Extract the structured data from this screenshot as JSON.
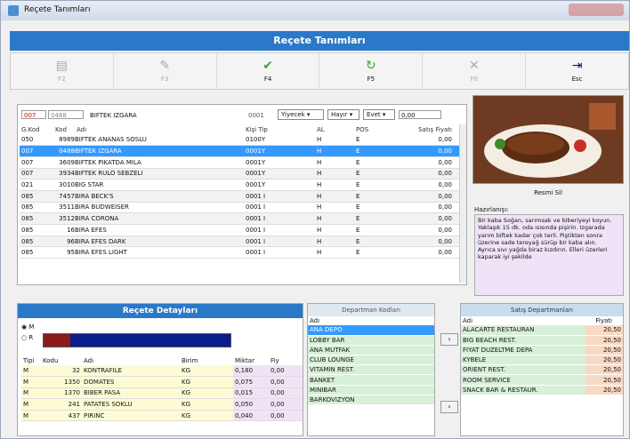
{
  "window": {
    "title": "Reçete Tanımları"
  },
  "header": {
    "title": "Reçete Tanımları"
  },
  "toolbar": [
    {
      "icon": "save-icon",
      "label": "F2",
      "enabled": false
    },
    {
      "icon": "edit-icon",
      "label": "F3",
      "enabled": false
    },
    {
      "icon": "check-icon",
      "label": "F4",
      "enabled": true
    },
    {
      "icon": "refresh-icon",
      "label": "F5",
      "enabled": true
    },
    {
      "icon": "close-icon",
      "label": "F6",
      "enabled": false
    },
    {
      "icon": "exit-icon",
      "label": "Esc",
      "enabled": true
    }
  ],
  "edit": {
    "code": "007",
    "code2": "0488",
    "name": "BIFTEK IZGARA",
    "type_code": "0001",
    "type": "Yiyecek",
    "al": "Hayır",
    "pos": "Evet",
    "price": "0,00"
  },
  "grid": {
    "columns": [
      "G.Kod",
      "Kod",
      "Adı",
      "Kişi Tip",
      "AL",
      "POS",
      "Satış Fiyatı"
    ],
    "rows": [
      {
        "g": "050",
        "kod": "8989",
        "ad": "BIFTEK ANANAS SOSLU",
        "tip": "0100Y",
        "al": "H",
        "pos": "E",
        "fiyat": "0,00"
      },
      {
        "g": "007",
        "kod": "0488",
        "ad": "BIFTEK IZGARA",
        "tip": "0001Y",
        "al": "H",
        "pos": "E",
        "fiyat": "0,00"
      },
      {
        "g": "007",
        "kod": "3609",
        "ad": "BIFTEK PIKATDA MILA",
        "tip": "0001Y",
        "al": "H",
        "pos": "E",
        "fiyat": "0,00"
      },
      {
        "g": "007",
        "kod": "3934",
        "ad": "BIFTEK RULO SEBZELI",
        "tip": "0001Y",
        "al": "H",
        "pos": "E",
        "fiyat": "0,00"
      },
      {
        "g": "021",
        "kod": "3010",
        "ad": "BIG STAR",
        "tip": "0001Y",
        "al": "H",
        "pos": "E",
        "fiyat": "0,00"
      },
      {
        "g": "085",
        "kod": "7457",
        "ad": "BIRA BECK'S",
        "tip": "0001 I",
        "al": "H",
        "pos": "E",
        "fiyat": "0,00"
      },
      {
        "g": "085",
        "kod": "3511",
        "ad": "BIRA BUDWEISER",
        "tip": "0001 I",
        "al": "H",
        "pos": "E",
        "fiyat": "0,00"
      },
      {
        "g": "085",
        "kod": "3512",
        "ad": "BIRA CORONA",
        "tip": "0001 I",
        "al": "H",
        "pos": "E",
        "fiyat": "0,00"
      },
      {
        "g": "085",
        "kod": "16",
        "ad": "BIRA EFES",
        "tip": "0001 I",
        "al": "H",
        "pos": "E",
        "fiyat": "0,00"
      },
      {
        "g": "085",
        "kod": "96",
        "ad": "BIRA EFES DARK",
        "tip": "0001 I",
        "al": "H",
        "pos": "E",
        "fiyat": "0,00"
      },
      {
        "g": "085",
        "kod": "95",
        "ad": "BIRA EFES LIGHT",
        "tip": "0001 I",
        "al": "H",
        "pos": "E",
        "fiyat": "0,00"
      }
    ]
  },
  "photo": {
    "label": "Resmi Sil"
  },
  "hazirlanis": {
    "label": "Hazırlanışı:",
    "text": "Bir kaba Soğan, sarımsak ve biberiyeyi koyun. Yaklaşık 15 dk. oda ısısında pişirin. Izgarada yarım biftek kadar çok terli. Piştikten sonra üzerine sade tereyağ sürüp bir kaba alın. Ayrıca sıvı yağda biraz kızdırın. Elleri üzerleri kaparak iyi şekilde"
  },
  "detail": {
    "title": "Reçete Detayları",
    "radio1": "M",
    "radio2": "R",
    "columns": [
      "Tipi",
      "Kodu",
      "Adı",
      "Birim",
      "Miktar",
      "Fiy"
    ],
    "rows": [
      {
        "t": "M",
        "k": "32",
        "ad": "KONTRAFILE",
        "b": "KG",
        "m": "0,180",
        "f": "0,00"
      },
      {
        "t": "M",
        "k": "1350",
        "ad": "DOMATES",
        "b": "KG",
        "m": "0,075",
        "f": "0,00"
      },
      {
        "t": "M",
        "k": "1370",
        "ad": "BIBER PASA",
        "b": "KG",
        "m": "0,015",
        "f": "0,00"
      },
      {
        "t": "M",
        "k": "241",
        "ad": "PATATES SOKLU",
        "b": "KG",
        "m": "0,050",
        "f": "0,00"
      },
      {
        "t": "M",
        "k": "437",
        "ad": "PIRINC",
        "b": "KG",
        "m": "0,040",
        "f": "0,00"
      }
    ]
  },
  "dept": {
    "title": "Departman Kodları",
    "col": "Adı",
    "items": [
      "ANA DEPO",
      "LOBBY BAR",
      "ANA MUTFAK",
      "CLUB LOUNGE",
      "VITAMIN REST.",
      "BANKET",
      "MINIBAR",
      "BARKOVIZYON"
    ]
  },
  "sales": {
    "title": "Satış Departmanları",
    "col1": "Adı",
    "col2": "Fiyatı",
    "items": [
      {
        "ad": "ALACARTE RESTAURAN",
        "f": "20,50"
      },
      {
        "ad": "BIG BEACH REST.",
        "f": "20,50"
      },
      {
        "ad": "FIYAT DUZELTME DEPA",
        "f": "20,50"
      },
      {
        "ad": "KYBELE",
        "f": "20,50"
      },
      {
        "ad": "ORIENT REST.",
        "f": "20,50"
      },
      {
        "ad": "ROOM SERVICE",
        "f": "20,50"
      },
      {
        "ad": "SNACK BAR & RESTAUR.",
        "f": "20,50"
      }
    ]
  },
  "arrows": {
    "right": "›",
    "left": "‹"
  }
}
